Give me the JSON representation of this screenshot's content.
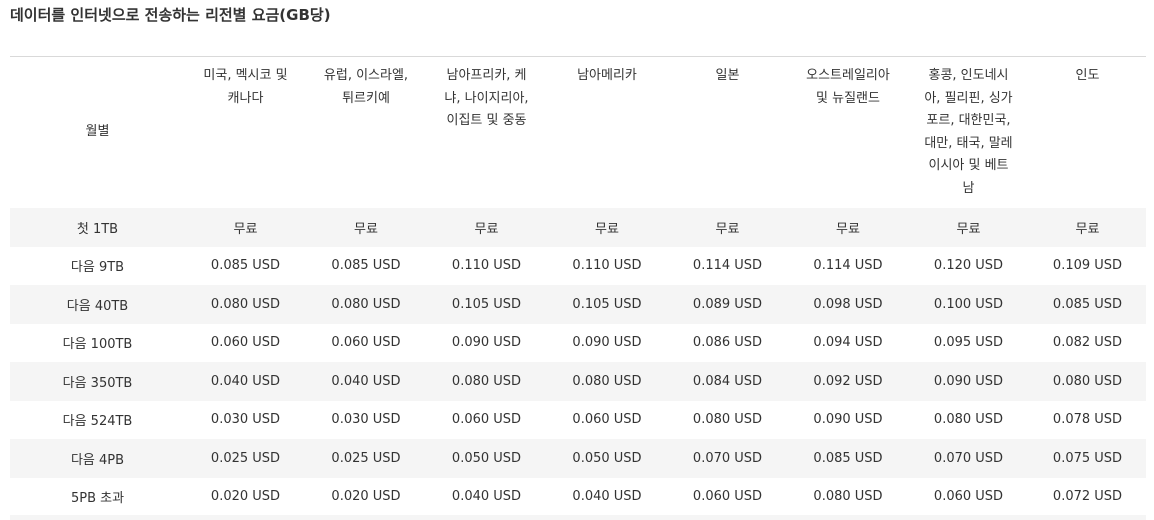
{
  "title": "데이터를 인터넷으로 전송하는 리전별 요금(GB당)",
  "table": {
    "headers": [
      "월별",
      "미국, 멕시코 및 캐나다",
      "유럽, 이스라엘, 튀르키예",
      "남아프리카, 케냐, 나이지리아, 이집트 및 중동",
      "남아메리카",
      "일본",
      "오스트레일리아 및 뉴질랜드",
      "홍콩, 인도네시아, 필리핀, 싱가포르, 대한민국, 대만, 태국, 말레이시아 및 베트남",
      "인도"
    ],
    "header_lines": [
      [
        "월별"
      ],
      [
        "미국, 멕시코 및",
        "캐나다"
      ],
      [
        "유럽, 이스라엘,",
        "튀르키예"
      ],
      [
        "남아프리카, 케",
        "냐, 나이지리아,",
        "이집트 및 중동"
      ],
      [
        "남아메리카"
      ],
      [
        "일본"
      ],
      [
        "오스트레일리아",
        "및 뉴질랜드"
      ],
      [
        "홍콩, 인도네시",
        "아, 필리핀, 싱가",
        "포르, 대한민국,",
        "대만, 태국, 말레",
        "이시아 및 베트",
        "남"
      ],
      [
        "인도"
      ]
    ],
    "rows": [
      [
        "첫 1TB",
        "무료",
        "무료",
        "무료",
        "무료",
        "무료",
        "무료",
        "무료",
        "무료"
      ],
      [
        "다음 9TB",
        "0.085 USD",
        "0.085 USD",
        "0.110 USD",
        "0.110 USD",
        "0.114 USD",
        "0.114 USD",
        "0.120 USD",
        "0.109 USD"
      ],
      [
        "다음 40TB",
        "0.080 USD",
        "0.080 USD",
        "0.105 USD",
        "0.105 USD",
        "0.089 USD",
        "0.098 USD",
        "0.100 USD",
        "0.085 USD"
      ],
      [
        "다음 100TB",
        "0.060 USD",
        "0.060 USD",
        "0.090 USD",
        "0.090 USD",
        "0.086 USD",
        "0.094 USD",
        "0.095 USD",
        "0.082 USD"
      ],
      [
        "다음 350TB",
        "0.040 USD",
        "0.040 USD",
        "0.080 USD",
        "0.080 USD",
        "0.084 USD",
        "0.092 USD",
        "0.090 USD",
        "0.080 USD"
      ],
      [
        "다음 524TB",
        "0.030 USD",
        "0.030 USD",
        "0.060 USD",
        "0.060 USD",
        "0.080 USD",
        "0.090 USD",
        "0.080 USD",
        "0.078 USD"
      ],
      [
        "다음 4PB",
        "0.025 USD",
        "0.025 USD",
        "0.050 USD",
        "0.050 USD",
        "0.070 USD",
        "0.085 USD",
        "0.070 USD",
        "0.075 USD"
      ],
      [
        "5PB 초과",
        "0.020 USD",
        "0.020 USD",
        "0.040 USD",
        "0.040 USD",
        "0.060 USD",
        "0.080 USD",
        "0.060 USD",
        "0.072 USD"
      ]
    ]
  },
  "colors": {
    "text": "#333333",
    "stripe": "#f5f5f5",
    "rule": "#d9d9d9",
    "background": "#ffffff"
  }
}
